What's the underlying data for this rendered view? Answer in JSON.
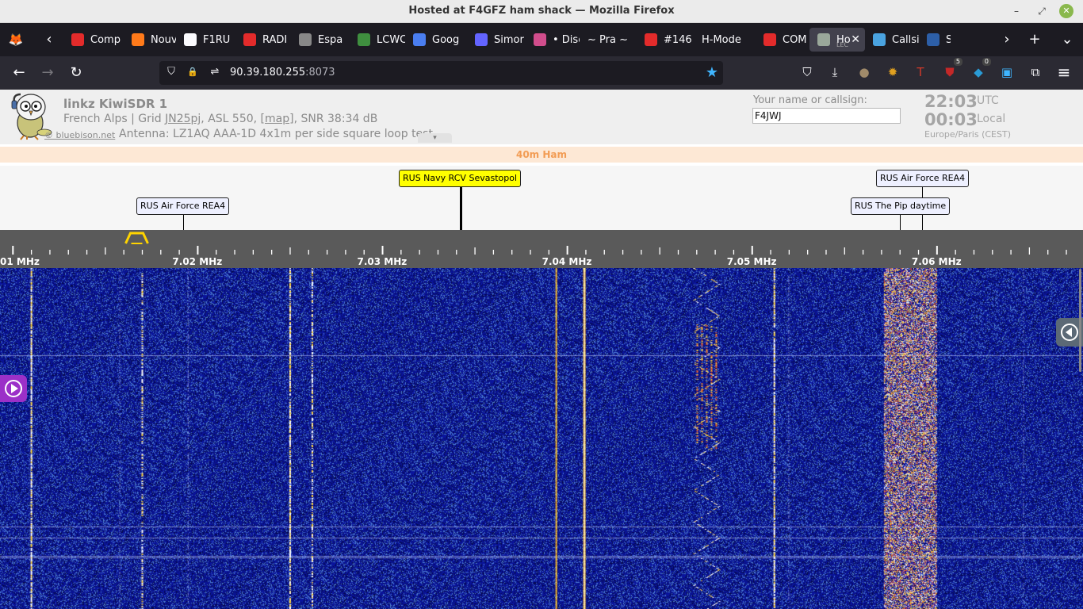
{
  "window": {
    "title": "Hosted at F4GFZ ham shack — Mozilla Firefox",
    "min_glyph": "–",
    "max_glyph": "⤢",
    "close_glyph": "✕"
  },
  "tabs": [
    {
      "label": "Comp",
      "icon": "youtube-icon",
      "color": "#e32b2b"
    },
    {
      "label": "Nouv",
      "icon": "firefox-icon",
      "color": "#ff7a1a"
    },
    {
      "label": "F1RU",
      "icon": "rocket-icon",
      "color": "#fbfbfe"
    },
    {
      "label": "RADI",
      "icon": "youtube-icon",
      "color": "#e32b2b"
    },
    {
      "label": "Espa",
      "icon": "satellite-icon",
      "color": "#888888"
    },
    {
      "label": "LCWC",
      "icon": "lcwo-icon",
      "color": "#3f8f3f"
    },
    {
      "label": "Goog",
      "icon": "google-translate-icon",
      "color": "#4a7ef0"
    },
    {
      "label": "Simor",
      "icon": "mastodon-icon",
      "color": "#6364ff"
    },
    {
      "label": "• Disc",
      "icon": "record-icon",
      "color": "#d14d8c"
    },
    {
      "label": "~ Pra ~",
      "icon": "",
      "color": ""
    },
    {
      "label": "#146",
      "icon": "youtube-icon",
      "color": "#e32b2b"
    },
    {
      "label": "H-Mode",
      "icon": "",
      "color": ""
    },
    {
      "label": "COM",
      "icon": "youtube-icon",
      "color": "#e32b2b"
    },
    {
      "label": "Ho",
      "icon": "kiwi-icon",
      "color": "#9aa89a",
      "sub": "LEC",
      "active": true
    },
    {
      "label": "Callsi",
      "icon": "grid-icon",
      "color": "#4aa3e0"
    },
    {
      "label": "S",
      "icon": "ref-icon",
      "color": "#2d5fa8"
    }
  ],
  "tabstrip": {
    "firefox_glyph": "🦊",
    "scroll_left": "‹",
    "scroll_right": "›",
    "new_tab": "+",
    "list_all": "⌄",
    "tab_close": "✕"
  },
  "nav": {
    "back": "←",
    "forward": "→",
    "reload": "↻",
    "url_host": "90.39.180.255",
    "url_port": ":8073",
    "shield": "⛉",
    "lock": "🔒",
    "perm": "⇌",
    "bookmark_star": "★",
    "pocket": "⛉",
    "download": "⤓",
    "menu": "≡",
    "ext": [
      {
        "name": "ext-potato-icon",
        "glyph": "●",
        "color": "#a08a6a",
        "badge": ""
      },
      {
        "name": "ext-sun-icon",
        "glyph": "✹",
        "color": "#e0a020",
        "badge": ""
      },
      {
        "name": "ext-t-icon",
        "glyph": "T",
        "color": "#d03a2a",
        "badge": ""
      },
      {
        "name": "ext-ublock-icon",
        "glyph": "⛊",
        "color": "#c42828",
        "badge": "5"
      },
      {
        "name": "ext-bag-icon",
        "glyph": "◆",
        "color": "#2a9bd6",
        "badge": "0"
      },
      {
        "name": "ext-save-icon",
        "glyph": "▣",
        "color": "#3fb5ff",
        "badge": ""
      },
      {
        "name": "extensions-icon",
        "glyph": "⧉",
        "color": "#fbfbfe",
        "badge": ""
      }
    ]
  },
  "kiwi": {
    "title": "linkz KiwiSDR 1",
    "loc_a": "French Alps | Grid ",
    "grid": "JN25pj",
    "loc_b": ", ASL 550, [",
    "map": "map",
    "loc_c": "], SNR 38:34 dB",
    "credit": "© bluebison.net",
    "antenna": "Antenna: LZ1AQ AAA-1D 4x1m per side square loop test",
    "collapse_glyph": "▾",
    "name_label": "Your name or callsign:",
    "name_value": "F4JWJ",
    "utc_time": "22:03",
    "utc_tag": "UTC",
    "local_time": "00:03",
    "local_tag": "Local",
    "timezone": "Europe/Paris (CEST)",
    "band": "40m Ham"
  },
  "dx_labels": [
    {
      "text": "RUS Air Force REA4",
      "freq": 7.0192,
      "row": 1,
      "highlight": false
    },
    {
      "text": "RUS Navy RCV Sevastopol",
      "freq": 7.0342,
      "row": 0,
      "highlight": true
    },
    {
      "text": "RUS Air Force REA4",
      "freq": 7.0592,
      "row": 0,
      "highlight": false
    },
    {
      "text": "RUS The Pip daytime",
      "freq": 7.058,
      "row": 1,
      "highlight": false
    }
  ],
  "scale": {
    "start_mhz": 7.0093,
    "end_mhz": 7.0679,
    "major_labels": [
      "01 MHz",
      "7.02 MHz",
      "7.03 MHz",
      "7.04 MHz",
      "7.05 MHz",
      "7.06 MHz"
    ],
    "major_freqs": [
      7.01,
      7.02,
      7.03,
      7.04,
      7.05,
      7.06
    ],
    "passband_center": 7.0167
  },
  "signals": [
    {
      "freq": 7.011,
      "kind": "cw",
      "strength": 0.9
    },
    {
      "freq": 7.0158,
      "kind": "faint",
      "strength": 0.35
    },
    {
      "freq": 7.017,
      "kind": "cw",
      "strength": 0.55
    },
    {
      "freq": 7.0195,
      "kind": "faint",
      "strength": 0.45
    },
    {
      "freq": 7.025,
      "kind": "cw",
      "strength": 0.8
    },
    {
      "freq": 7.0262,
      "kind": "cw",
      "strength": 0.6
    },
    {
      "freq": 7.0394,
      "kind": "carrier",
      "strength": 0.6
    },
    {
      "freq": 7.0409,
      "kind": "carrier",
      "strength": 1.0
    },
    {
      "freq": 7.0475,
      "kind": "fsk",
      "strength": 0.85
    },
    {
      "freq": 7.0512,
      "kind": "cw",
      "strength": 0.85
    },
    {
      "freq": 7.052,
      "kind": "faint",
      "strength": 0.4
    },
    {
      "freq": 7.0585,
      "kind": "wide",
      "strength": 1.0
    },
    {
      "freq": 7.0647,
      "kind": "faint",
      "strength": 0.35
    }
  ],
  "colors": {
    "waterfall_bg": "#0e1a8a",
    "band_text": "#f29c54",
    "passband": "#ffd400",
    "dx_highlight": "#ffff00"
  }
}
